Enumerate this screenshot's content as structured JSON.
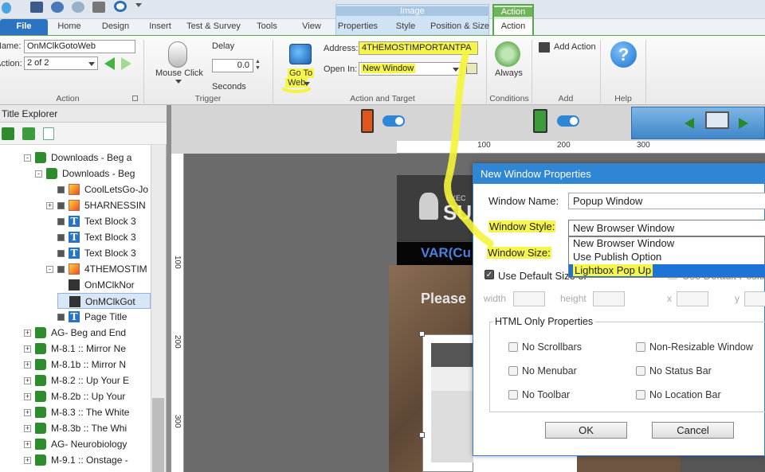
{
  "tabs": {
    "file": "File",
    "home": "Home",
    "design": "Design",
    "insert": "Insert",
    "test_survey": "Test & Survey",
    "tools": "Tools",
    "view": "View",
    "properties": "Properties",
    "style": "Style",
    "position_size": "Position & Size",
    "action": "Action"
  },
  "context_groups": {
    "image": "Image",
    "action": "Action"
  },
  "ribbon": {
    "name_label": "Name:",
    "name_value": "OnMClkGotoWeb",
    "action_label": "Action:",
    "action_value": "2 of 2",
    "mouse_click": "Mouse Click",
    "delay_label": "Delay",
    "delay_value": "0.0",
    "seconds": "Seconds",
    "go_to_web_line1": "Go To",
    "go_to_web_line2": "Web",
    "address_label": "Address:",
    "address_value": "4THEMOSTIMPORTANTPA",
    "open_in_label": "Open In:",
    "open_in_value": "New Window",
    "always": "Always",
    "add_action": "Add Action",
    "help": "Help",
    "groups": {
      "action": "Action",
      "trigger": "Trigger",
      "action_target": "Action and Target",
      "conditions": "Conditions",
      "add": "Add",
      "help": "Help"
    }
  },
  "explorer": {
    "title": "Title Explorer",
    "rows": [
      {
        "label": "Downloads - Beg a",
        "icon": "book"
      },
      {
        "label": "Downloads - Beg",
        "icon": "book"
      },
      {
        "label": "CoolLetsGo-Jo",
        "icon": "image"
      },
      {
        "label": "5HARNESSIN",
        "icon": "image"
      },
      {
        "label": "Text Block 3",
        "icon": "text"
      },
      {
        "label": "Text Block 3",
        "icon": "text"
      },
      {
        "label": "Text Block 3",
        "icon": "text"
      },
      {
        "label": "4THEMOSTIM",
        "icon": "image"
      },
      {
        "label": "OnMClkNor",
        "icon": "clapper"
      },
      {
        "label": "OnMClkGot",
        "icon": "clapper"
      },
      {
        "label": "Page Title",
        "icon": "text"
      },
      {
        "label": "AG- Beg and End",
        "icon": "book"
      },
      {
        "label": "M-8.1 :: Mirror Ne",
        "icon": "book"
      },
      {
        "label": "M-8.1b :: Mirror N",
        "icon": "book"
      },
      {
        "label": "M-8.2 :: Up Your E",
        "icon": "book"
      },
      {
        "label": "M-8.2b :: Up Your",
        "icon": "book"
      },
      {
        "label": "M-8.3 :: The White",
        "icon": "book"
      },
      {
        "label": "M-8.3b :: The Whi",
        "icon": "book"
      },
      {
        "label": "AG- Neurobiology",
        "icon": "book"
      },
      {
        "label": "M-9.1 :: Onstage -",
        "icon": "book"
      }
    ]
  },
  "canvas": {
    "ruler_h": [
      "100",
      "200",
      "300"
    ],
    "ruler_v": [
      "100",
      "200",
      "300"
    ],
    "page_header_var": "VAR(Cu",
    "page_please": "Please",
    "logo_text": "SU",
    "logo_small": "EXEC"
  },
  "dialog": {
    "title": "New Window Properties",
    "window_name_label": "Window Name:",
    "window_name_value": "Popup Window",
    "window_style_label": "Window Style:",
    "window_style_value": "New Browser Window",
    "window_size_label": "Window Size:",
    "use_default_size": "Use Default Size or",
    "use_default_position": "Use Default Positi",
    "width": "width",
    "height": "height",
    "x": "x",
    "y": "y",
    "html_only": "HTML Only Properties",
    "no_scrollbars": "No Scrollbars",
    "non_resizable": "Non-Resizable Window",
    "no_menubar": "No Menubar",
    "no_status_bar": "No Status Bar",
    "no_toolbar": "No Toolbar",
    "no_location_bar": "No Location Bar",
    "ok": "OK",
    "cancel": "Cancel",
    "dropdown_options": [
      "New Browser Window",
      "Use Publish Option",
      "Lightbox Pop Up"
    ]
  },
  "colors": {
    "accent": "#2f86d4",
    "highlight": "#f6f64a",
    "action_green": "#5aa74a"
  }
}
